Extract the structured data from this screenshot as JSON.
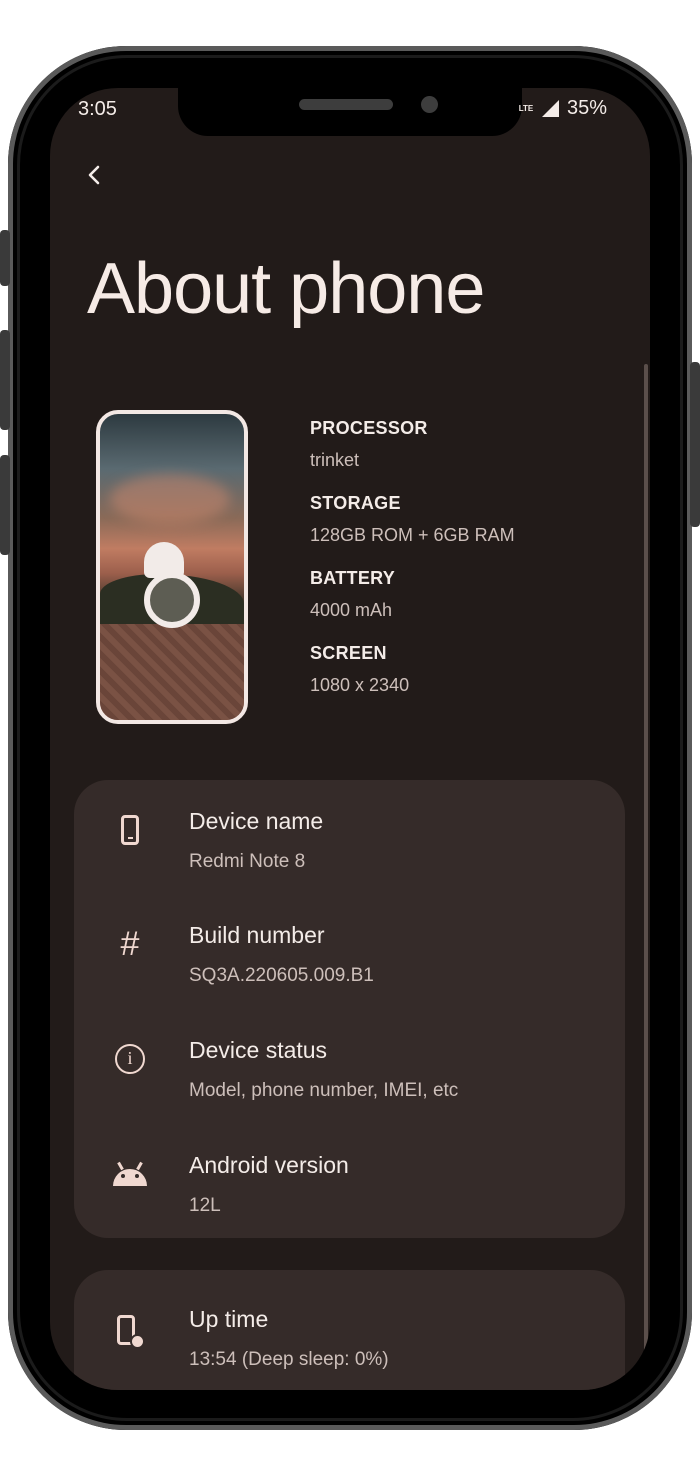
{
  "status_bar": {
    "time": "3:05",
    "network": "LTE",
    "battery": "35%"
  },
  "header": {
    "back_icon": "chevron-left-icon",
    "title": "About phone"
  },
  "specs": [
    {
      "label": "PROCESSOR",
      "value": "trinket"
    },
    {
      "label": "STORAGE",
      "value": "128GB ROM + 6GB RAM"
    },
    {
      "label": "BATTERY",
      "value": "4000 mAh"
    },
    {
      "label": "SCREEN",
      "value": "1080 x 2340"
    }
  ],
  "info_card": {
    "rows": [
      {
        "icon": "device-icon",
        "title": "Device name",
        "subtitle": "Redmi Note 8"
      },
      {
        "icon": "hash-icon",
        "title": "Build number",
        "subtitle": "SQ3A.220605.009.B1"
      },
      {
        "icon": "info-icon",
        "title": "Device status",
        "subtitle": "Model, phone number, IMEI, etc"
      },
      {
        "icon": "android-icon",
        "title": "Android version",
        "subtitle": "12L"
      }
    ]
  },
  "uptime_card": {
    "icon": "uptime-icon",
    "title": "Up time",
    "subtitle": "13:54 (Deep sleep: 0%)"
  },
  "colors": {
    "background": "#221b19",
    "card": "#352b29",
    "text_primary": "#f4ece8",
    "text_secondary": "#cdbfba",
    "icon_tint": "#f0d8d0"
  }
}
